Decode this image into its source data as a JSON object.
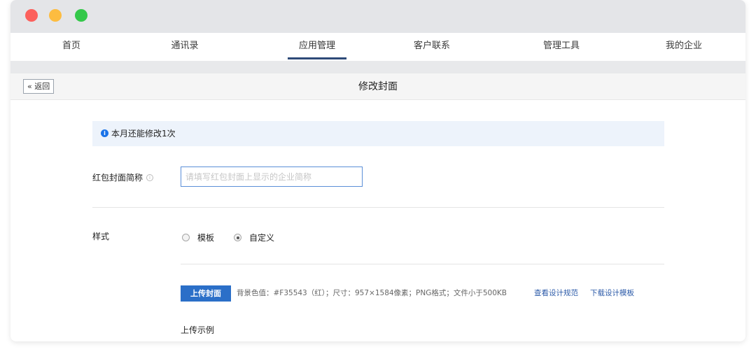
{
  "nav": {
    "items": [
      {
        "label": "首页"
      },
      {
        "label": "通讯录"
      },
      {
        "label": "应用管理",
        "active": true
      },
      {
        "label": "客户联系"
      },
      {
        "label": "管理工具"
      },
      {
        "label": "我的企业"
      }
    ],
    "active_color": "#2e4a78"
  },
  "subheader": {
    "back_label": "« 返回",
    "title": "修改封面"
  },
  "notice": {
    "text": "本月还能修改1次",
    "icon": "info-icon"
  },
  "form": {
    "name_label": "红包封面简称",
    "name_placeholder": "请填写红包封面上显示的企业简称",
    "name_value": "",
    "style_label": "样式",
    "style_options": [
      {
        "label": "模板",
        "checked": false
      },
      {
        "label": "自定义",
        "checked": true
      }
    ],
    "upload_label": "上传封面",
    "upload_desc": "背景色值：#F35543（红）；尺寸：957×1584像素；PNG格式；文件小于500KB",
    "link_spec": "查看设计规范",
    "link_template": "下载设计模板",
    "example_label": "上传示例"
  },
  "colors": {
    "accent": "#2b6fc8",
    "link": "#2b5aa8",
    "notice_bg": "#edf3fb"
  }
}
